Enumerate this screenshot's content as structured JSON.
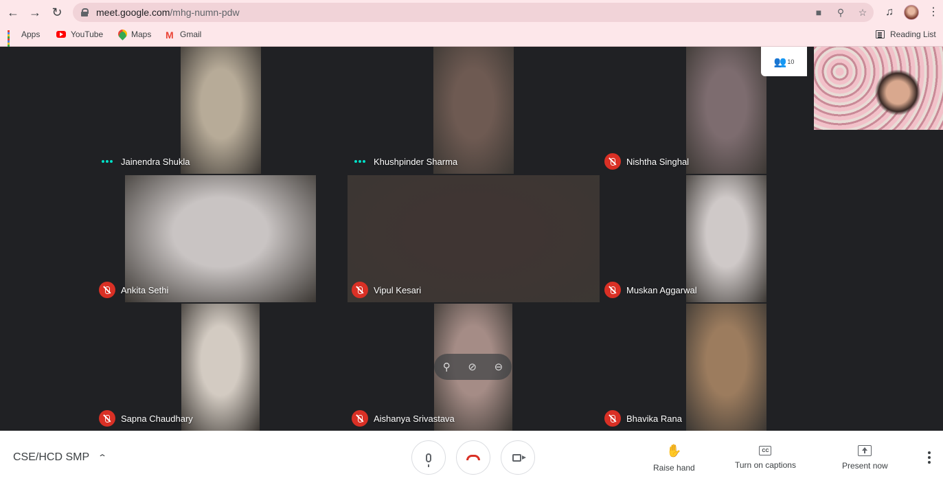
{
  "browser": {
    "url_host": "meet.google.com",
    "url_path": "/mhg-numn-pdw",
    "bookmarks": [
      "Apps",
      "YouTube",
      "Maps",
      "Gmail"
    ],
    "reading_list": "Reading List"
  },
  "meet": {
    "participant_count": "10",
    "participants": [
      {
        "name": "Jainendra Shukla",
        "status": "speaking",
        "video_color": "#b7ab98"
      },
      {
        "name": "Khushpinder Sharma",
        "status": "speaking",
        "video_color": "#6e5a52"
      },
      {
        "name": "Nishtha Singhal",
        "status": "muted",
        "video_color": "#7d6c6f"
      },
      {
        "name": "Ankita Sethi",
        "status": "muted",
        "video_color": "#c9c4c3"
      },
      {
        "name": "Vipul Kesari",
        "status": "muted",
        "video_color": "#3f3533"
      },
      {
        "name": "Muskan Aggarwal",
        "status": "muted",
        "video_color": "#cfc9c8"
      },
      {
        "name": "Sapna Chaudhary",
        "status": "muted",
        "video_color": "#d3cbc2"
      },
      {
        "name": "Aishanya Srivastava",
        "status": "muted",
        "video_color": "#a58c86"
      },
      {
        "name": "Bhavika Rana",
        "status": "muted",
        "video_color": "#9c7c5e"
      }
    ],
    "meeting_title": "CSE/HCD SMP",
    "actions": {
      "raise_hand": "Raise hand",
      "captions": "Turn on captions",
      "present": "Present now"
    }
  }
}
